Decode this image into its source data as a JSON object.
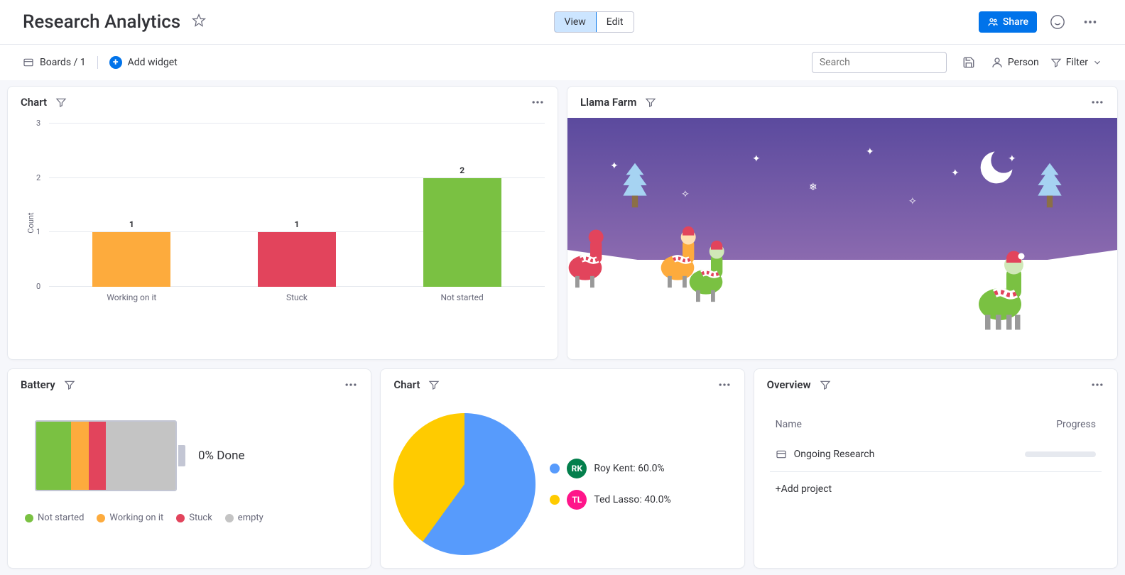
{
  "header": {
    "title": "Research Analytics",
    "view_label": "View",
    "edit_label": "Edit",
    "share_label": "Share"
  },
  "toolbar": {
    "boards_label": "Boards / 1",
    "add_widget_label": "Add widget",
    "search_placeholder": "Search",
    "person_label": "Person",
    "filter_label": "Filter"
  },
  "colors": {
    "working": "#fdab3d",
    "stuck": "#e2445c",
    "not_started": "#7ac142",
    "empty": "#c4c4c4",
    "blue": "#579bfc",
    "yellow": "#ffcb00",
    "rk_avatar": "#037f4c",
    "tl_avatar": "#ff158a"
  },
  "widgets": {
    "bar": {
      "title": "Chart"
    },
    "llama": {
      "title": "Llama Farm"
    },
    "battery": {
      "title": "Battery",
      "status_text": "0% Done",
      "legend": [
        {
          "label": "Not started",
          "color_key": "not_started"
        },
        {
          "label": "Working on it",
          "color_key": "working"
        },
        {
          "label": "Stuck",
          "color_key": "stuck"
        },
        {
          "label": "empty",
          "color_key": "empty"
        }
      ]
    },
    "pie": {
      "title": "Chart",
      "legend": [
        {
          "initials": "RK",
          "label": "Roy Kent: 60.0%",
          "avatar_key": "rk_avatar",
          "dot_key": "blue"
        },
        {
          "initials": "TL",
          "label": "Ted Lasso: 40.0%",
          "avatar_key": "tl_avatar",
          "dot_key": "yellow"
        }
      ]
    },
    "overview": {
      "title": "Overview",
      "col_name": "Name",
      "col_progress": "Progress",
      "rows": [
        {
          "name": "Ongoing Research"
        }
      ],
      "add_label": "+Add project"
    }
  },
  "chart_data": [
    {
      "widget": "bar",
      "type": "bar",
      "ylabel": "Count",
      "ylim": [
        0,
        3
      ],
      "yticks": [
        0,
        1,
        2,
        3
      ],
      "categories": [
        "Working on it",
        "Stuck",
        "Not started"
      ],
      "values": [
        1,
        1,
        2
      ],
      "colors": [
        "#fdab3d",
        "#e2445c",
        "#7ac142"
      ]
    },
    {
      "widget": "battery",
      "type": "bar",
      "orientation": "horizontal-stacked",
      "segments": [
        {
          "label": "Not started",
          "value": 25,
          "color": "#7ac142"
        },
        {
          "label": "Working on it",
          "value": 12.5,
          "color": "#fdab3d"
        },
        {
          "label": "Stuck",
          "value": 12.5,
          "color": "#e2445c"
        },
        {
          "label": "empty",
          "value": 50,
          "color": "#c4c4c4"
        }
      ],
      "done_percent": 0
    },
    {
      "widget": "pie",
      "type": "pie",
      "slices": [
        {
          "label": "Roy Kent",
          "value": 60.0,
          "color": "#579bfc"
        },
        {
          "label": "Ted Lasso",
          "value": 40.0,
          "color": "#ffcb00"
        }
      ]
    }
  ]
}
